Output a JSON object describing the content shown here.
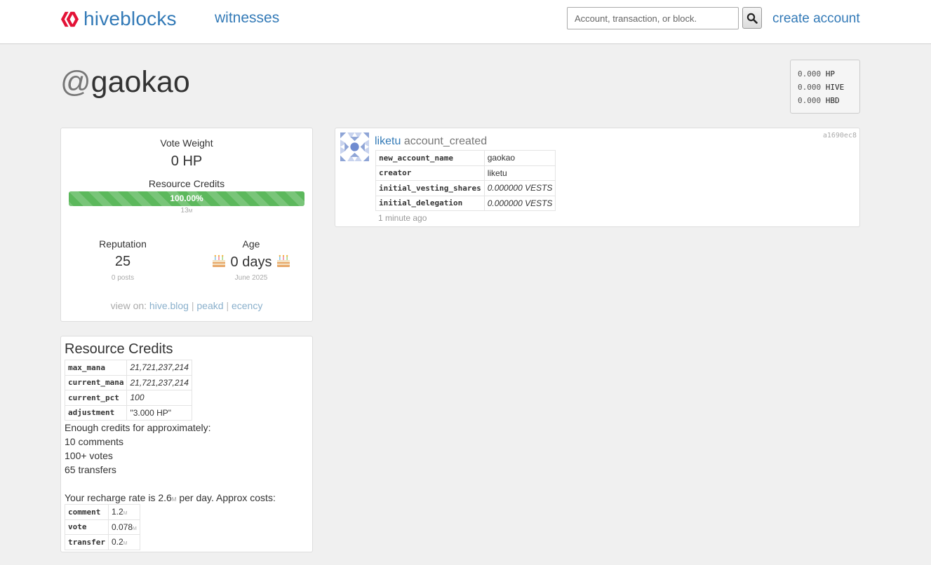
{
  "nav": {
    "logo_text": "hiveblocks",
    "witnesses_link": "witnesses",
    "search_placeholder": "Account, transaction, or block.",
    "create_account_link": "create account",
    "colors": {
      "link": "#337ab7",
      "logo_red": "#e31337"
    }
  },
  "account": {
    "at": "@",
    "name": "gaokao"
  },
  "balances": [
    {
      "amount": "0.000",
      "unit": "HP"
    },
    {
      "amount": "0.000",
      "unit": "HIVE"
    },
    {
      "amount": "0.000",
      "unit": "HBD"
    }
  ],
  "stats": {
    "vote_weight_label": "Vote Weight",
    "vote_weight_value": "0 HP",
    "rc_label": "Resource Credits",
    "rc_pct_text": "100.00%",
    "rc_pct": 100,
    "rc_sub_value": "13",
    "rc_sub_unit": "M",
    "reputation_label": "Reputation",
    "reputation_value": "25",
    "posts_text": "0 posts",
    "age_label": "Age",
    "age_value": "0 days",
    "age_date": "June 2025",
    "view_on_label": "view on:",
    "links": [
      "hive.blog",
      "peakd",
      "ecency"
    ],
    "separator": "|",
    "bar_color": "#5cb85c"
  },
  "rc": {
    "title": "Resource Credits",
    "rows": [
      {
        "key": "max_mana",
        "value": "21,721,237,214"
      },
      {
        "key": "current_mana",
        "value": "21,721,237,214"
      },
      {
        "key": "current_pct",
        "value": "100"
      },
      {
        "key": "adjustment",
        "value": "\"3.000 HP\""
      }
    ],
    "enough_text": "Enough credits for approximately:",
    "estimates": [
      "10 comments",
      "100+ votes",
      "65 transfers"
    ],
    "recharge_prefix": "Your recharge rate is 2.6",
    "recharge_unit": "M",
    "recharge_suffix": " per day. Approx costs:",
    "costs": [
      {
        "key": "comment",
        "value": "1.2",
        "unit": "M"
      },
      {
        "key": "vote",
        "value": "0.078",
        "unit": "M"
      },
      {
        "key": "transfer",
        "value": "0.2",
        "unit": "M"
      }
    ]
  },
  "operation": {
    "actor": "liketu",
    "type": "account_created",
    "trx_id": "a1690ec8",
    "fields": [
      {
        "key": "new_account_name",
        "value": "gaokao"
      },
      {
        "key": "creator",
        "value": "liketu"
      },
      {
        "key": "initial_vesting_shares",
        "value": "0.000000 VESTS"
      },
      {
        "key": "initial_delegation",
        "value": "0.000000 VESTS"
      }
    ],
    "time": "1 minute ago",
    "avatar_icon": "identicon-avatar"
  }
}
